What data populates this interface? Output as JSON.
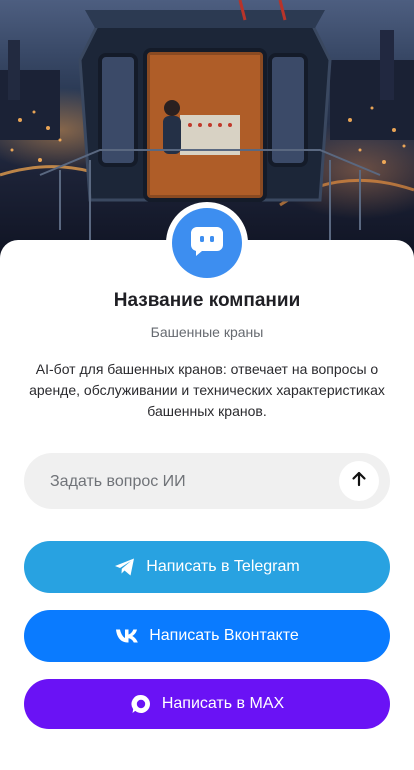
{
  "hero": {
    "image_alt": "tower-crane-cabin-night-city",
    "icon": "hero-photo"
  },
  "profile": {
    "avatar_icon": "chat-bot-icon",
    "avatar_color": "#3d8ef0",
    "company_name": "Название компании",
    "subtitle": "Башенные краны",
    "description": "AI-бот для башенных кранов: отвечает на вопросы о аренде, обслуживании и технических характеристиках башенных кранов."
  },
  "ask": {
    "placeholder": "Задать вопрос ИИ",
    "value": "",
    "send_icon": "arrow-up-icon"
  },
  "buttons": {
    "telegram": {
      "label": "Написать в Telegram",
      "icon": "telegram-icon",
      "color": "#28a2e1"
    },
    "vk": {
      "label": "Написать Вконтакте",
      "icon": "vk-icon",
      "color": "#0a7bff"
    },
    "max": {
      "label": "Написать в MAX",
      "icon": "max-icon",
      "color": "#6a12f5"
    }
  }
}
